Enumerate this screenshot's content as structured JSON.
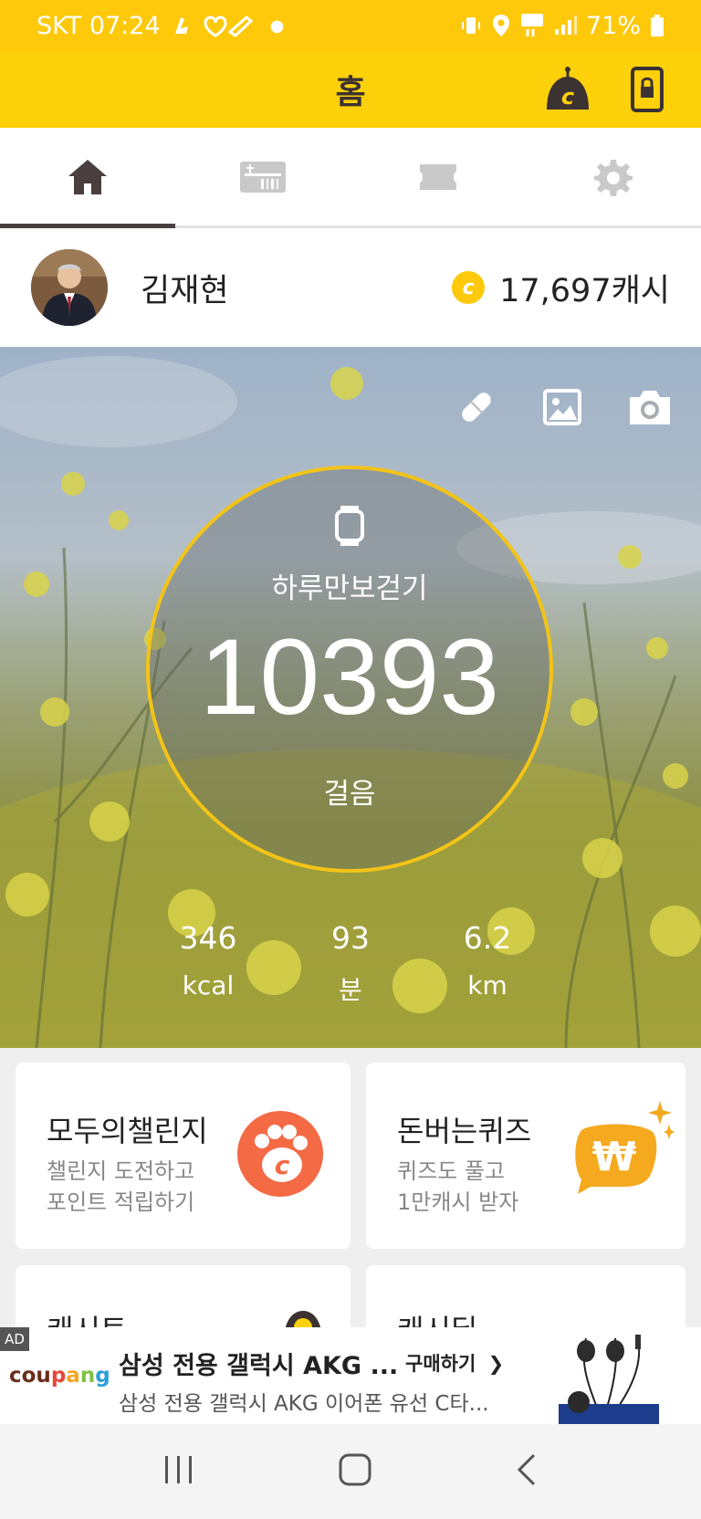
{
  "status": {
    "carrier_time": "SKT 07:24",
    "battery": "71%"
  },
  "appbar": {
    "title": "홈"
  },
  "tabs": [
    "home-icon",
    "gift-icon",
    "ticket-icon",
    "gear-icon"
  ],
  "profile": {
    "name": "김재현",
    "cash": "17,697캐시",
    "coin_letter": "c"
  },
  "steps": {
    "label": "하루만보걷기",
    "count": "10393",
    "unit": "걸음",
    "stats": [
      {
        "value": "346",
        "unit": "kcal"
      },
      {
        "value": "93",
        "unit": "분"
      },
      {
        "value": "6.2",
        "unit": "km"
      }
    ]
  },
  "cards": [
    {
      "title": "모두의챌린지",
      "desc1": "챌린지 도전하고",
      "desc2": "포인트 적립하기"
    },
    {
      "title": "돈버는퀴즈",
      "desc1": "퀴즈도 풀고",
      "desc2": "1만캐시 받자"
    },
    {
      "title": "캐시토"
    },
    {
      "title": "캐시딜"
    }
  ],
  "ad": {
    "tag": "AD",
    "brand": "coupang",
    "title": "삼성 전용 갤럭시 AKG ...",
    "cta": "구매하기",
    "subtitle": "삼성 전용 갤럭시 AKG 이어폰 유선 C타..."
  },
  "colors": {
    "accent": "#fdd10a",
    "dark": "#3c3232",
    "ring": "#f3c417"
  }
}
